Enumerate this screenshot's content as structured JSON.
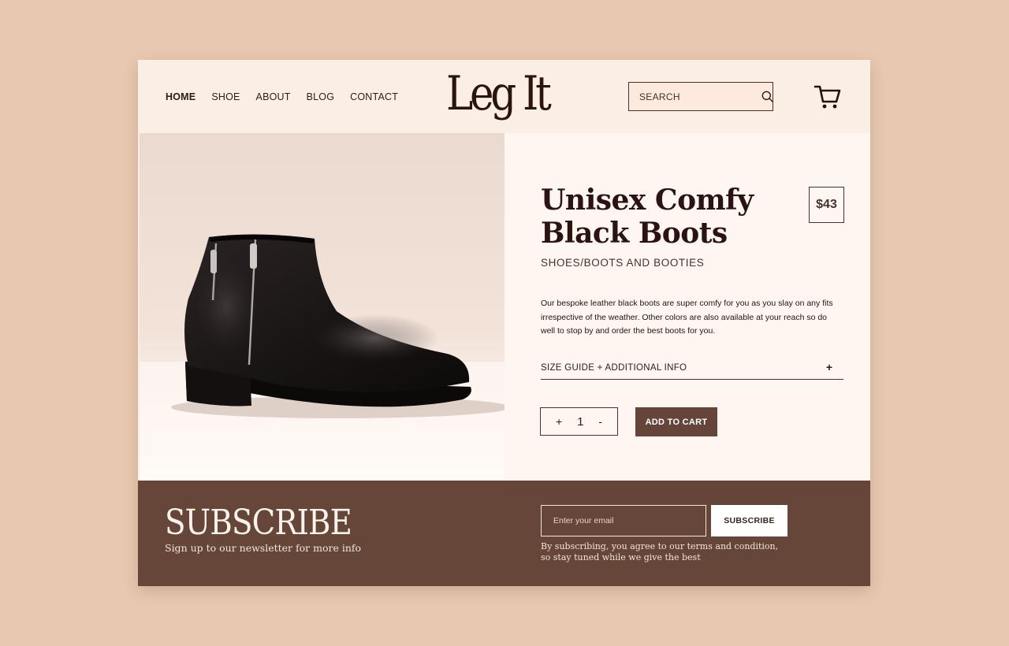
{
  "brand": {
    "logo": "Leg It"
  },
  "nav": {
    "items": [
      {
        "label": "HOME",
        "active": true
      },
      {
        "label": "SHOE",
        "active": false
      },
      {
        "label": "ABOUT",
        "active": false
      },
      {
        "label": "BLOG",
        "active": false
      },
      {
        "label": "CONTACT",
        "active": false
      }
    ]
  },
  "search": {
    "placeholder": "SEARCH",
    "icon": "search-icon"
  },
  "cart": {
    "icon": "cart-icon"
  },
  "product": {
    "title": "Unisex Comfy Black Boots",
    "price": "$43",
    "category": "SHOES/BOOTS AND BOOTIES",
    "description": "Our bespoke leather black boots are super comfy for you as you slay on any fits irrespective of the weather. Other colors are also available at your reach so do well to stop by and order the best boots for you.",
    "accordion_label": "SIZE GUIDE + ADDITIONAL INFO",
    "accordion_icon": "+",
    "quantity": {
      "increment": "+",
      "value": "1",
      "decrement": "-"
    },
    "add_to_cart": "ADD TO CART"
  },
  "subscribe": {
    "title": "SUBSCRIBE",
    "tagline": "Sign up to our newsletter for more info",
    "email_placeholder": "Enter your email",
    "button": "SUBSCRIBE",
    "note": "By subscribing, you agree to our terms and condition, so stay tuned while we give the best"
  },
  "colors": {
    "page_background": "#e8c8b0",
    "header_background": "#fbeee4",
    "accent_brown": "#654638",
    "dark_text": "#2b1410"
  }
}
